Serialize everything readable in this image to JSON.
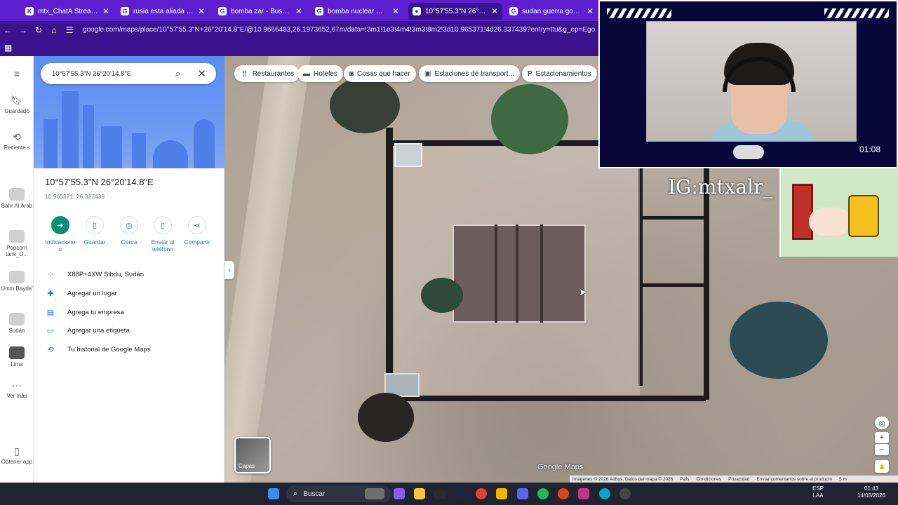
{
  "browser": {
    "tabs": [
      {
        "title": "mtx_ChatA Stream - Waï",
        "active": false
      },
      {
        "title": "rusia esta aliada con coré",
        "active": false
      },
      {
        "title": "bomba zar - Buscar con G",
        "active": false
      },
      {
        "title": "bomba nuclear mas fuerté",
        "active": false
      },
      {
        "title": "10°57'55.3\"N 26°20'14.8\"E",
        "active": true
      },
      {
        "title": "sudan guerra google ma",
        "active": false
      }
    ],
    "url": "google.com/maps/place/10°57'55.3\"N+26°20'14.8\"E/@10.9666483,26.1973652,67m/data=!3m1!1e3!4m4!3m3!8m2!3d10.965371!4d26.337439?entry=ttu&g_ep=EgoyMDI2MDM"
  },
  "rail": {
    "items": [
      {
        "label": "Guardado"
      },
      {
        "label": "Reciente s"
      },
      {
        "label": "Bahr Al Arab"
      },
      {
        "label": "Popcorn tank_U..."
      },
      {
        "label": "Umm Bayda'"
      },
      {
        "label": "Sudán"
      },
      {
        "label": "Lima"
      },
      {
        "label": "Ver más"
      },
      {
        "label": "Obtener app"
      }
    ]
  },
  "panel": {
    "search_value": "10°57'55.3\"N 26°20'14.8\"E",
    "title": "10°57'55.3\"N 26°20'14.8\"E",
    "subtitle": "10.965371, 26.337439",
    "actions": [
      {
        "label": "Indicacione s"
      },
      {
        "label": "Guardar"
      },
      {
        "label": "Cerca"
      },
      {
        "label": "Enviar al teléfono"
      },
      {
        "label": "Compartir"
      }
    ],
    "list": [
      {
        "label": "X88P+4XW Sibdu, Sudán",
        "icon": "plus-code-icon"
      },
      {
        "label": "Agregar un lugar",
        "icon": "add-place-icon"
      },
      {
        "label": "Agrega tu empresa",
        "icon": "business-icon"
      },
      {
        "label": "Agregar una etiqueta",
        "icon": "label-icon"
      },
      {
        "label": "Tu historial de Google Maps",
        "icon": "history-icon"
      }
    ]
  },
  "map": {
    "chips": [
      {
        "label": "Restaurantes"
      },
      {
        "label": "Hoteles"
      },
      {
        "label": "Cosas que hacer"
      },
      {
        "label": "Estaciones de transport..."
      },
      {
        "label": "Estacionamientos"
      }
    ],
    "layers_label": "Capas",
    "logo": "Google Maps",
    "footer": [
      "Imágenes © 2026 Airbus, Datos del mapa © 2026",
      "País",
      "Condiciones",
      "Privacidad",
      "Enviar comentarios sobre el producto",
      "5 m"
    ]
  },
  "overlay": {
    "timer": "01:08",
    "ig_handle": "IG:mtxalr_"
  },
  "taskbar": {
    "search": "Buscar",
    "lang_top": "ESP",
    "lang_bottom": "LAA",
    "time": "01:43",
    "date": "14/03/2026"
  }
}
